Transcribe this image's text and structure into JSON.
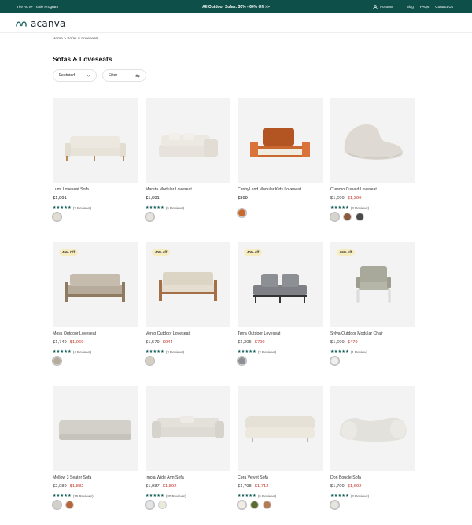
{
  "topbar": {
    "trade": "The ACV+ Trade Program",
    "promo": "All Outdoor Sofas: 30% - 60% Off >>",
    "account": "Account",
    "blog": "Blog",
    "faqs": "FAQs",
    "contact": "Contact Us"
  },
  "header": {
    "logo": "acanva"
  },
  "breadcrumb": "Home > Sofas & Loveseats",
  "page_title": "Sofas & Loveseats",
  "sort": {
    "label": "Featured"
  },
  "filter": {
    "label": "Filter"
  },
  "products": [
    {
      "name": "Lumi Loveseat Sofa",
      "price": "$1,091",
      "original": "",
      "reviews": "(3 Reviews)",
      "badge": "",
      "swatches": [
        "#e2ddd3"
      ]
    },
    {
      "name": "Mareta Modular Loveseat",
      "price": "$1,691",
      "original": "",
      "reviews": "(5 Reviews)",
      "badge": "",
      "swatches": [
        "#e6e3dc"
      ]
    },
    {
      "name": "CushyLand Modular Kids Loveseat",
      "price": "$899",
      "original": "",
      "reviews": "",
      "badge": "",
      "swatches": [
        "#c9682f"
      ]
    },
    {
      "name": "Cresmo Curved Loveseat",
      "price": "$1,399",
      "original": "$1,699",
      "reviews": "(3 Reviews)",
      "badge": "",
      "swatches": [
        "#d8d5ce",
        "#8b5a3c",
        "#4a4a4a"
      ]
    },
    {
      "name": "Moss Outdoor Loveseat",
      "price": "$1,069",
      "original": "$1,749",
      "reviews": "(4 Reviews)",
      "badge": "40% Off",
      "swatches": [
        "#b7ab9c"
      ]
    },
    {
      "name": "Vento Outdoor Loveseat",
      "price": "$944",
      "original": "$1,579",
      "reviews": "(3 Reviews)",
      "badge": "40% off",
      "swatches": [
        "#d6cfc0"
      ]
    },
    {
      "name": "Terra Outdoor Loveseat",
      "price": "$799",
      "original": "$1,305",
      "reviews": "(2 Reviews)",
      "badge": "40% off",
      "swatches": [
        "#8c8f93"
      ]
    },
    {
      "name": "Sylva Outdoor Modular Chair",
      "price": "$479",
      "original": "$1,699",
      "reviews": "(1 Review)",
      "badge": "65% off",
      "swatches": [
        "#f0efed"
      ]
    },
    {
      "name": "Mellow 3 Seater Sofa",
      "price": "$1,882",
      "original": "$2,089",
      "reviews": "(15 Reviews)",
      "badge": "",
      "swatches": [
        "#d3d0ca",
        "#b7653a"
      ]
    },
    {
      "name": "Imola Wide Arm Sofa",
      "price": "$1,892",
      "original": "$1,987",
      "reviews": "(80 Reviews)",
      "badge": "",
      "swatches": [
        "#e4e4e6",
        "#e9ead9"
      ]
    },
    {
      "name": "Cora Velvet Sofa",
      "price": "$1,712",
      "original": "$1,798",
      "reviews": "(5 Reviews)",
      "badge": "",
      "swatches": [
        "#f2ede2",
        "#5a6b2f",
        "#b57b55"
      ]
    },
    {
      "name": "Don Boucle Sofa",
      "price": "$1,692",
      "original": "$1,709",
      "reviews": "(3 Reviews)",
      "badge": "",
      "swatches": [
        "#e6e5e0"
      ]
    }
  ],
  "colors": {
    "brand": "#0f4f4a",
    "sale": "#c0392b",
    "star": "#0f5a55",
    "badge_bg": "#f7ecc0"
  }
}
